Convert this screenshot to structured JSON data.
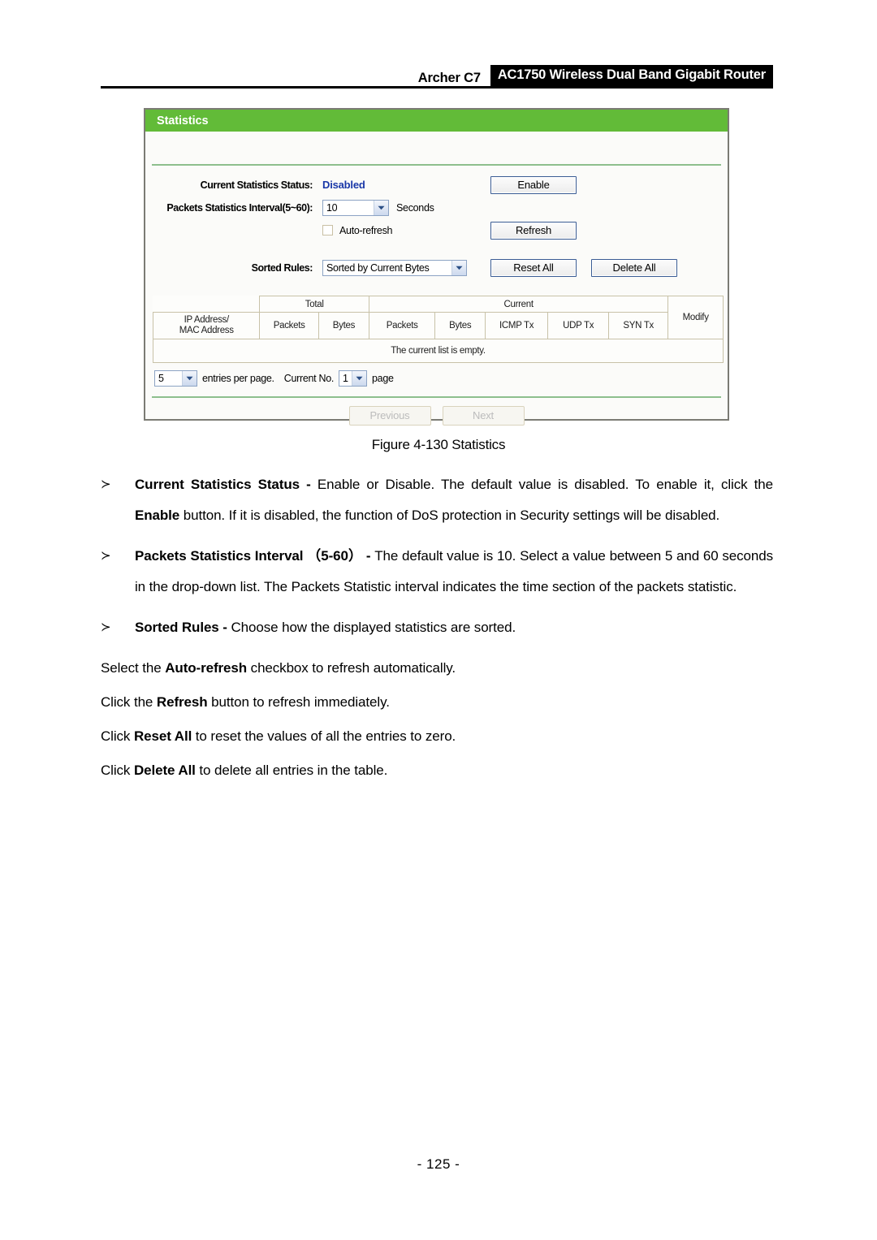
{
  "header": {
    "model": "Archer C7",
    "product": "AC1750 Wireless Dual Band Gigabit Router"
  },
  "panel": {
    "title": "Statistics",
    "status_label": "Current Statistics Status:",
    "status_value": "Disabled",
    "enable_button": "Enable",
    "interval_label": "Packets Statistics Interval(5~60):",
    "interval_value": "10",
    "interval_unit": "Seconds",
    "autorefresh_label": "Auto-refresh",
    "refresh_button": "Refresh",
    "sorted_label": "Sorted Rules:",
    "sorted_value": "Sorted by Current Bytes",
    "reset_all_button": "Reset All",
    "delete_all_button": "Delete All",
    "table": {
      "group_total": "Total",
      "group_current": "Current",
      "col_address": "IP Address/\nMAC Address",
      "col_address_line1": "IP Address/",
      "col_address_line2": "MAC Address",
      "col_total_packets": "Packets",
      "col_total_bytes": "Bytes",
      "col_current_packets": "Packets",
      "col_current_bytes": "Bytes",
      "col_icmp_tx": "ICMP Tx",
      "col_udp_tx": "UDP Tx",
      "col_syn_tx": "SYN Tx",
      "col_modify": "Modify",
      "empty_message": "The current list is empty."
    },
    "pager": {
      "entries_value": "5",
      "entries_text": "entries per page.",
      "current_no_text": "Current No.",
      "page_value": "1",
      "page_text": "page",
      "previous_button": "Previous",
      "next_button": "Next"
    }
  },
  "figure_caption": "Figure 4-130 Statistics",
  "body": {
    "bullet_mark": "≻",
    "p1_term": "Current Statistics Status",
    "p1_dash": " - ",
    "p1_t1": "Enable or Disable. The default value is disabled. To enable it, click the ",
    "p1_b1": "Enable",
    "p1_t2": " button. If it is disabled, the function of DoS protection in Security settings will be disabled.",
    "p2_term": "Packets Statistics Interval",
    "p2_range": "（5-60）",
    "p2_dash": " - ",
    "p2_text": "The default value is 10. Select a value between 5 and 60 seconds in the drop-down list. The Packets Statistic interval indicates the time section of the packets statistic.",
    "p3_term": "Sorted Rules",
    "p3_dash": " - ",
    "p3_text": "Choose how the displayed statistics are sorted.",
    "p4_t1": "Select the ",
    "p4_b1": "Auto-refresh",
    "p4_t2": " checkbox to refresh automatically.",
    "p5_t1": "Click the ",
    "p5_b1": "Refresh",
    "p5_t2": " button to refresh immediately.",
    "p6_t1": "Click ",
    "p6_b1": "Reset All",
    "p6_t2": " to reset the values of all the entries to zero.",
    "p7_t1": "Click ",
    "p7_b1": "Delete All",
    "p7_t2": " to delete all entries in the table."
  },
  "page_number": "- 125 -",
  "colors": {
    "brand_green": "#62bb38",
    "status_blue": "#1a38a8",
    "table_border": "#c8c2a8"
  }
}
